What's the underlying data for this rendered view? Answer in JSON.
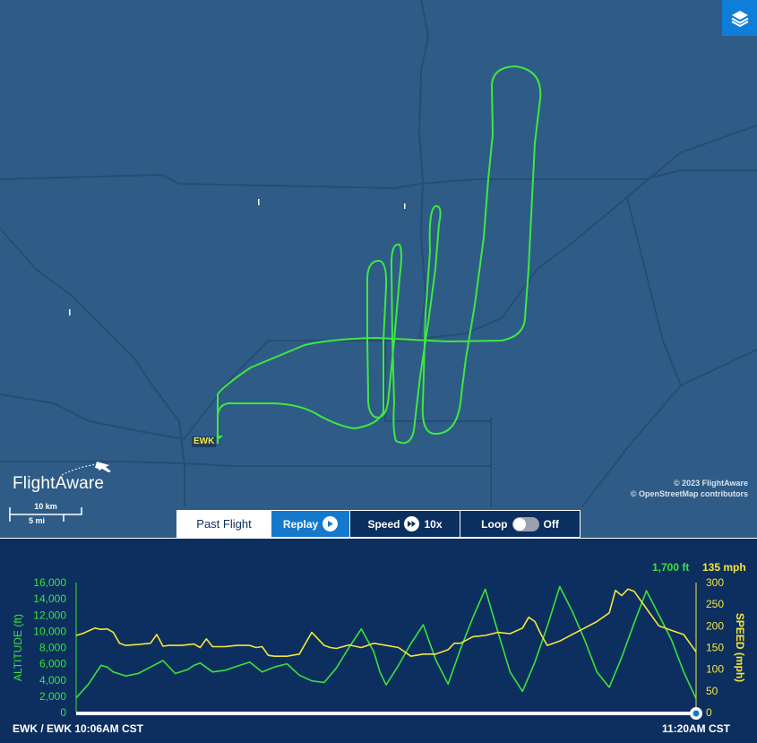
{
  "map": {
    "airport_code": "EWK",
    "brand": "FlightAware",
    "scale": {
      "km": "10 km",
      "mi": "5 mi"
    },
    "copyright": {
      "line1": "© 2023 FlightAware",
      "line2": "© OpenStreetMap contributors"
    },
    "track_color": "#3ee83e",
    "icon": "layers-icon"
  },
  "controls": {
    "past_flight": "Past Flight",
    "replay": "Replay",
    "speed_label": "Speed",
    "speed_value": "10x",
    "loop_label": "Loop",
    "loop_state": "Off"
  },
  "chart_data": {
    "type": "line",
    "x_start_label": "EWK / EWK 10:06AM CST",
    "x_end_label": "11:20AM CST",
    "current_altitude": "1,700 ft",
    "current_speed": "135 mph",
    "y_left": {
      "label": "ALTITUDE (ft)",
      "ticks": [
        "0",
        "2,000",
        "4,000",
        "6,000",
        "8,000",
        "10,000",
        "12,000",
        "14,000",
        "16,000"
      ],
      "range": [
        0,
        16000
      ],
      "color": "#3be23b"
    },
    "y_right": {
      "label": "SPEED (mph)",
      "ticks": [
        "0",
        "50",
        "100",
        "150",
        "200",
        "250",
        "300"
      ],
      "range": [
        0,
        300
      ],
      "color": "#f5e63a"
    },
    "x_range": [
      0,
      100
    ],
    "series": [
      {
        "axis": "left",
        "color": "#3be23b",
        "x": [
          0,
          2,
          4,
          5,
          6,
          8,
          10,
          12,
          14,
          16,
          18,
          19,
          20,
          22,
          24,
          26,
          28,
          30,
          31,
          32,
          34,
          36,
          38,
          40,
          42,
          44,
          46,
          48,
          49,
          50,
          52,
          54,
          56,
          58,
          60,
          62,
          64,
          66,
          68,
          70,
          72,
          74,
          76,
          78,
          80,
          82,
          84,
          86,
          88,
          90,
          92,
          94,
          96,
          98,
          100
        ],
        "y": [
          1800,
          3500,
          5800,
          5600,
          5000,
          4500,
          4800,
          5600,
          6400,
          4800,
          5300,
          5800,
          6100,
          5000,
          5200,
          5700,
          6200,
          5000,
          5300,
          5600,
          6000,
          4600,
          3900,
          3700,
          5500,
          8000,
          10300,
          7500,
          5000,
          3400,
          5800,
          8500,
          10800,
          6500,
          3500,
          7800,
          11700,
          15200,
          10000,
          5000,
          2600,
          6200,
          10600,
          15500,
          12500,
          9000,
          5000,
          3100,
          6800,
          11000,
          15000,
          12000,
          9000,
          5000,
          1700
        ]
      },
      {
        "axis": "right",
        "color": "#f5e63a",
        "x": [
          0,
          1,
          3,
          4,
          5,
          6,
          7,
          8,
          10,
          12,
          13,
          14,
          15,
          17,
          19,
          20,
          21,
          22,
          24,
          26,
          28,
          29,
          30,
          31,
          32,
          34,
          36,
          38,
          40,
          41,
          42,
          44,
          46,
          48,
          50,
          52,
          54,
          56,
          58,
          60,
          61,
          62,
          64,
          66,
          68,
          70,
          72,
          73,
          74,
          75,
          76,
          78,
          80,
          82,
          84,
          86,
          87,
          88,
          89,
          90,
          92,
          94,
          96,
          98,
          100
        ],
        "y": [
          178,
          182,
          195,
          192,
          193,
          185,
          160,
          155,
          157,
          160,
          180,
          153,
          155,
          155,
          158,
          150,
          170,
          152,
          152,
          155,
          155,
          150,
          152,
          132,
          130,
          130,
          135,
          185,
          155,
          150,
          148,
          156,
          150,
          160,
          155,
          150,
          130,
          135,
          135,
          145,
          160,
          160,
          175,
          178,
          185,
          182,
          195,
          220,
          210,
          180,
          155,
          165,
          180,
          195,
          210,
          230,
          282,
          270,
          285,
          280,
          240,
          200,
          190,
          180,
          140
        ]
      }
    ]
  }
}
